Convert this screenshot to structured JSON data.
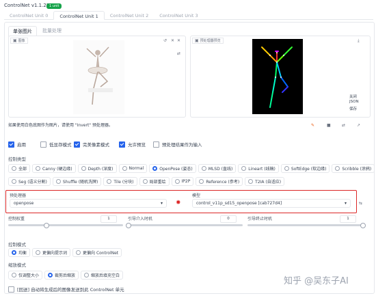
{
  "header": {
    "title": "ControlNet v1.1.224",
    "badge": "1 unit"
  },
  "units": [
    {
      "label": "ControlNet Unit 0"
    },
    {
      "label": "ControlNet Unit 1"
    },
    {
      "label": "ControlNet Unit 2"
    },
    {
      "label": "ControlNet Unit 3"
    }
  ],
  "subtabs": {
    "single": "单张图片",
    "batch": "批量处理"
  },
  "image_panel": {
    "label": "图像"
  },
  "preview_panel": {
    "label": "预处理器预览",
    "side": {
      "close": "关闭",
      "json": "JSON",
      "download": "保存"
    }
  },
  "hint_text": "如果使用白色底图作为图片，请使用 \"Invert\" 预处理器。",
  "toolbar_icons": [
    "brush-icon",
    "camera-icon",
    "swap-icon",
    "arrow-icon"
  ],
  "options": [
    {
      "label": "启用",
      "checked": true
    },
    {
      "label": "低显存模式",
      "checked": false
    },
    {
      "label": "完美像素模式",
      "checked": true
    },
    {
      "label": "允许预览",
      "checked": true
    },
    {
      "label": "预处理结果作为输入",
      "checked": false
    }
  ],
  "control_type": {
    "label": "控制类型",
    "row1": [
      "全部",
      "Canny (硬边缘)",
      "Depth (深度)",
      "Normal",
      "OpenPose (姿态)",
      "MLSD (直线)",
      "Lineart (线稿)",
      "SoftEdge (软边缘)",
      "Scribble (涂鸦)"
    ],
    "row2": [
      "Seg (语义分割)",
      "Shuffle (随机洗牌)",
      "Tile (分块)",
      "局部重绘",
      "IP2P",
      "Reference (参考)",
      "T2IA (自适应)"
    ],
    "selected": "OpenPose (姿态)"
  },
  "preprocessor": {
    "label": "预处理器",
    "value": "openpose"
  },
  "model": {
    "label": "模型",
    "value": "control_v11p_sd15_openpose [cab727d4]"
  },
  "sliders": {
    "weight": {
      "label": "控制权重",
      "value": "1",
      "fraction": 0.33
    },
    "start": {
      "label": "引导介入时机",
      "value": "0",
      "fraction": 0.0
    },
    "end": {
      "label": "引导终止时机",
      "value": "1",
      "fraction": 1.0
    }
  },
  "control_mode": {
    "label": "控制模式",
    "options": [
      "均衡",
      "更偏向提示词",
      "更偏向 ControlNet"
    ],
    "selected": "均衡"
  },
  "resize_mode": {
    "label": "缩放模式",
    "options": [
      "仅调整大小",
      "裁剪后缩放",
      "缩放后填充空白"
    ],
    "selected": "裁剪后缩放"
  },
  "footer_checkbox": {
    "label": "[回送] 自动将生成后的图像发送到此 ControlNet 单元",
    "checked": false
  },
  "watermark": "知乎 @吴东子AI",
  "colors": {
    "accent": "#2563eb",
    "highlight": "#dc2626",
    "badge": "#16a34a"
  }
}
